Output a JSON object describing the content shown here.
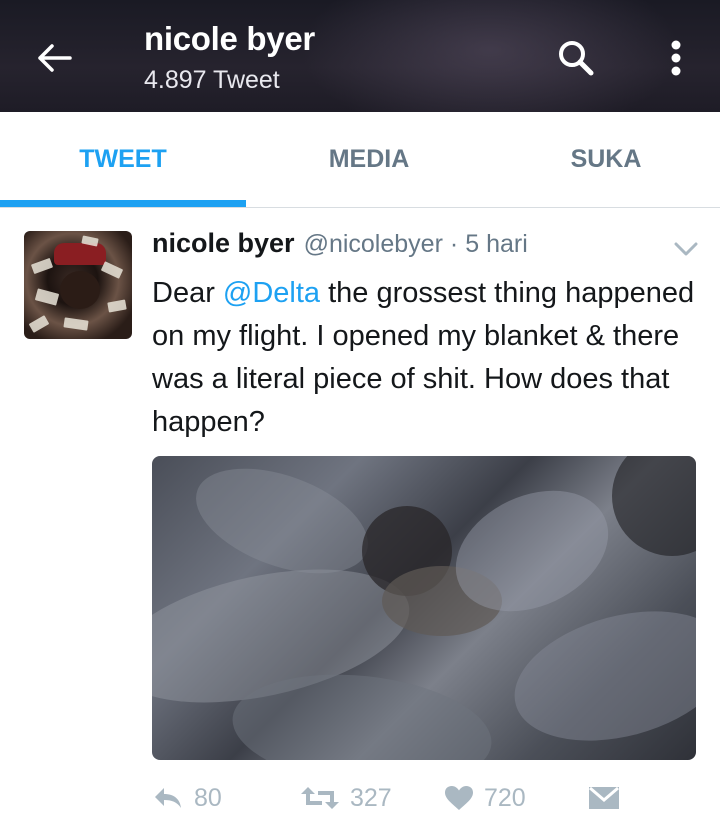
{
  "header": {
    "title": "nicole byer",
    "subtitle": "4.897 Tweet"
  },
  "tabs": [
    {
      "label": "TWEET",
      "active": true
    },
    {
      "label": "MEDIA",
      "active": false
    },
    {
      "label": "SUKA",
      "active": false
    }
  ],
  "tweet": {
    "author_name": "nicole byer",
    "handle": "@nicolebyer",
    "separator": "·",
    "time": "5 hari",
    "text_before": "Dear ",
    "mention": "@Delta",
    "text_after": " the grossest thing happened on my flight. I opened my blanket & there was a literal piece of shit. How does that happen?",
    "replies": "80",
    "retweets": "327",
    "likes": "720"
  },
  "colors": {
    "accent": "#1da1f2",
    "muted": "#657786",
    "action_gray": "#aab8c2"
  },
  "icons": [
    "back-arrow-icon",
    "search-icon",
    "more-vertical-icon",
    "chevron-down-icon",
    "reply-icon",
    "retweet-icon",
    "heart-icon",
    "direct-message-icon"
  ]
}
